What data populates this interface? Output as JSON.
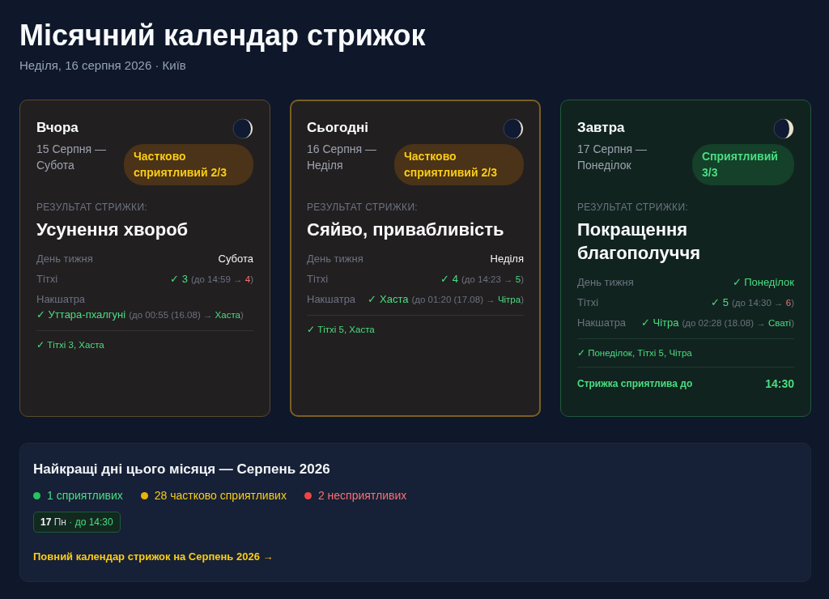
{
  "title": "Місячний календар стрижок",
  "subtitle": "Неділя, 16 серпня 2026 · Київ",
  "cards": [
    {
      "heading": "Вчора",
      "date": "15 Серпня — Субота",
      "today": false,
      "badge": {
        "text": "Частково сприятливий 2/3",
        "kind": "partial"
      },
      "result_label": "РЕЗУЛЬТАТ СТРИЖКИ:",
      "result": "Усунення хвороб",
      "rows": [
        {
          "label": "День тижня",
          "value": "Субота",
          "good": false
        },
        {
          "label": "Тітхі",
          "value": "✓ 3",
          "good": true,
          "note": "(до 14:59 →",
          "next": "4",
          "next_good": false,
          "close": ")"
        },
        {
          "label": "Накшатра",
          "value": "✓ Уттара-пхалгуні",
          "good": true,
          "note": "(до 00:55 (16.08) →",
          "next": "Хаста",
          "next_good": true,
          "close": ")"
        }
      ],
      "summary": "✓ Тітхі 3, Хаста"
    },
    {
      "heading": "Сьогодні",
      "date": "16 Серпня — Неділя",
      "today": true,
      "badge": {
        "text": "Частково сприятливий 2/3",
        "kind": "partial"
      },
      "result_label": "РЕЗУЛЬТАТ СТРИЖКИ:",
      "result": "Сяйво, привабливість",
      "rows": [
        {
          "label": "День тижня",
          "value": "Неділя",
          "good": false
        },
        {
          "label": "Тітхі",
          "value": "✓ 4",
          "good": true,
          "note": "(до 14:23 →",
          "next": "5",
          "next_good": true,
          "close": ")"
        },
        {
          "label": "Накшатра",
          "value": "✓ Хаста",
          "good": true,
          "note": "(до 01:20 (17.08) →",
          "next": "Чітра",
          "next_good": true,
          "close": ")"
        }
      ],
      "summary": "✓ Тітхі 5, Хаста"
    },
    {
      "heading": "Завтра",
      "date": "17 Серпня — Понеділок",
      "today": false,
      "badge": {
        "text": "Сприятливий 3/3",
        "kind": "favorable"
      },
      "result_label": "РЕЗУЛЬТАТ СТРИЖКИ:",
      "result": "Покращення благополуччя",
      "rows": [
        {
          "label": "День тижня",
          "value": "✓ Понеділок",
          "good": true
        },
        {
          "label": "Тітхі",
          "value": "✓ 5",
          "good": true,
          "note": "(до 14:30 →",
          "next": "6",
          "next_good": false,
          "close": ")"
        },
        {
          "label": "Накшатра",
          "value": "✓ Чітра",
          "good": true,
          "note": "(до 02:28 (18.08) →",
          "next": "Сваті",
          "next_good": true,
          "close": ")"
        }
      ],
      "summary": "✓ Понеділок, Тітхі 5, Чітра",
      "footer": {
        "label": "Стрижка сприятлива до",
        "time": "14:30"
      }
    }
  ],
  "month": {
    "title": "Найкращі дні цього місяця — Серпень 2026",
    "legend": [
      {
        "text": "1 сприятливих",
        "color": "#22c55e"
      },
      {
        "text": "28 частково сприятливих",
        "color": "#eab308"
      },
      {
        "text": "2 несприятливих",
        "color": "#ef4444"
      }
    ],
    "days": [
      {
        "day": "17",
        "weekday": "Пн",
        "time": "· до 14:30"
      }
    ],
    "link": "Повний календар стрижок на Серпень 2026 →"
  }
}
